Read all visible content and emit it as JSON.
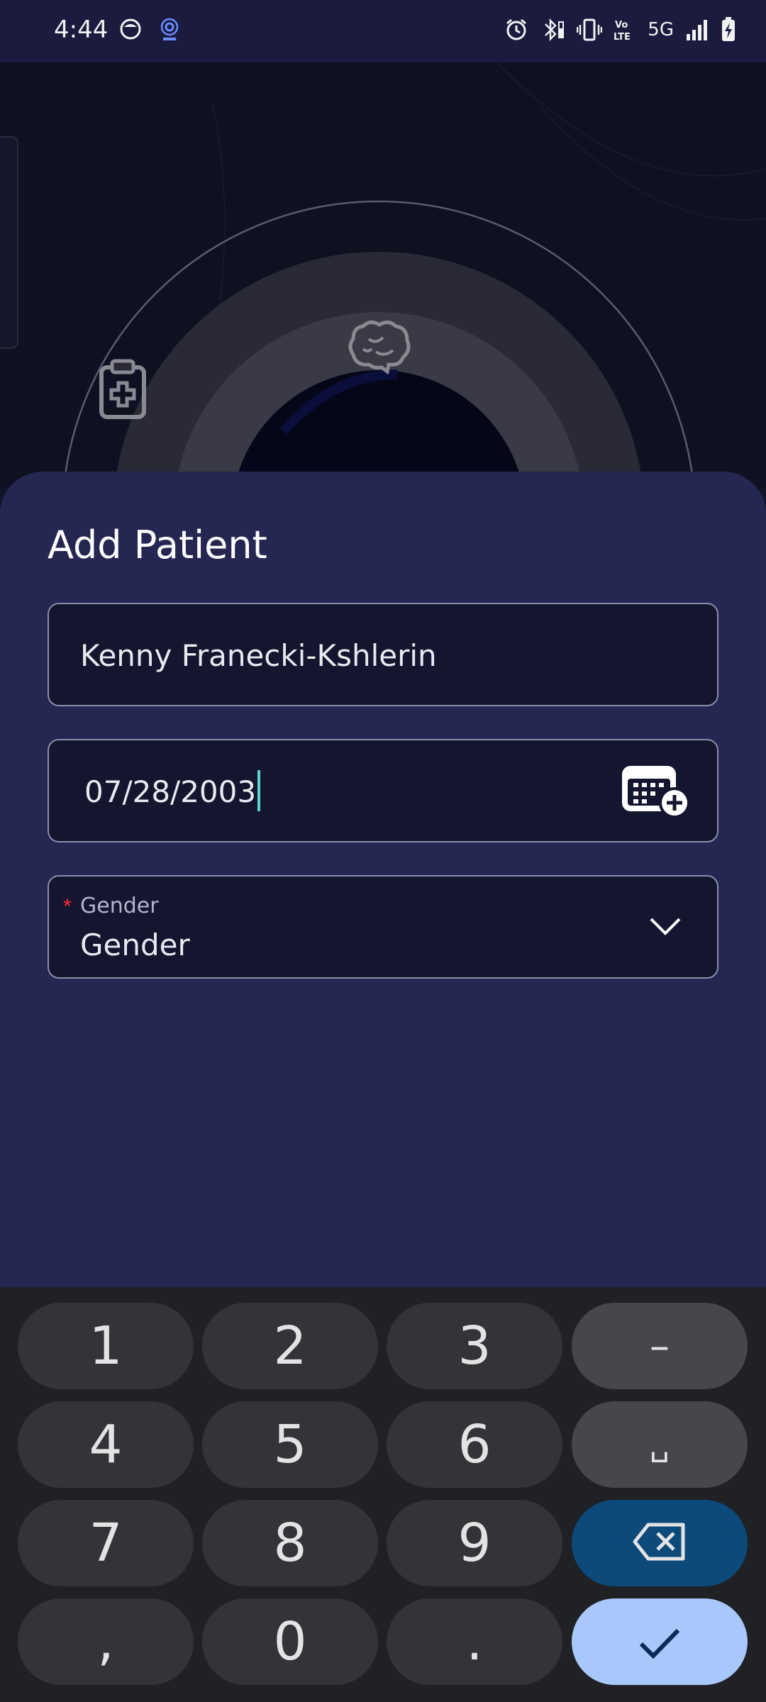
{
  "status_bar": {
    "time": "4:44",
    "network": "5G",
    "icons": [
      "face-notification-icon",
      "hotspot-icon",
      "alarm-icon",
      "bluetooth-icon",
      "vibrate-icon",
      "volte-icon",
      "signal-icon",
      "battery-charging-icon"
    ]
  },
  "background": {
    "icons": [
      "clipboard-medical-icon",
      "brain-icon"
    ]
  },
  "sheet": {
    "title": "Add Patient",
    "name_field": {
      "value": "Kenny Franecki-Kshlerin"
    },
    "date_field": {
      "value": "07/28/2003",
      "icon": "calendar-add-icon"
    },
    "gender_field": {
      "label": "Gender",
      "required_mark": "*",
      "value": "Gender",
      "icon": "chevron-down-icon"
    }
  },
  "keyboard": {
    "rows": [
      [
        "1",
        "2",
        "3",
        "–"
      ],
      [
        "4",
        "5",
        "6",
        "␣"
      ],
      [
        "7",
        "8",
        "9",
        "backspace"
      ],
      [
        ",",
        "0",
        ".",
        "enter"
      ]
    ],
    "dash": "–",
    "space": "␣",
    "backspace_icon": "backspace-icon",
    "enter_icon": "check-icon"
  },
  "colors": {
    "sheet_bg": "#262653",
    "field_bg": "#14152f",
    "accent_caret": "#5fd3d3",
    "required": "#ff2b2b",
    "enter_key": "#a8c7fa",
    "backspace_key": "#0b4a7b"
  }
}
